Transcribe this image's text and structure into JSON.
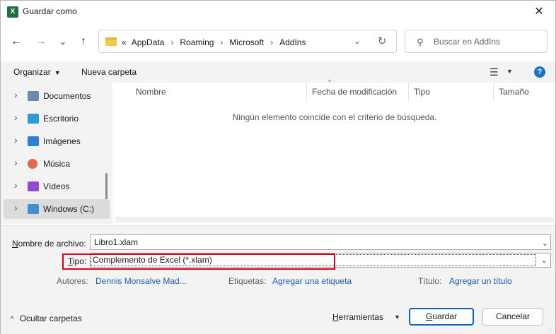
{
  "window": {
    "app_icon_letter": "X",
    "title": "Guardar como",
    "close_symbol": "✕"
  },
  "nav": {
    "back_symbol": "←",
    "forward_symbol": "→",
    "recent_symbol": "⌄",
    "up_symbol": "↑",
    "breadcrumb_overflow": "«",
    "breadcrumb": [
      "AppData",
      "Roaming",
      "Microsoft",
      "AddIns"
    ],
    "breadcrumb_separator": "›",
    "dropdown_symbol": "⌄",
    "refresh_symbol": "↻",
    "search_placeholder": "Buscar en AddIns"
  },
  "toolbar": {
    "organize_label": "Organizar",
    "new_folder_label": "Nueva carpeta",
    "view_symbol": "☰",
    "help_symbol": "?"
  },
  "sidebar": {
    "items": [
      {
        "label": "Documentos",
        "icon": "documents-icon",
        "color": "#6b8cae",
        "selected": false
      },
      {
        "label": "Escritorio",
        "icon": "desktop-icon",
        "color": "#2a9bd6",
        "selected": false
      },
      {
        "label": "Imágenes",
        "icon": "pictures-icon",
        "color": "#2f7fd0",
        "selected": false
      },
      {
        "label": "Música",
        "icon": "music-icon",
        "color": "#e0694f",
        "selected": false
      },
      {
        "label": "Vídeos",
        "icon": "videos-icon",
        "color": "#8e4bd1",
        "selected": false
      },
      {
        "label": "Windows (C:)",
        "icon": "drive-icon",
        "color": "#3d8fd6",
        "selected": true
      }
    ]
  },
  "file_list": {
    "columns": [
      "Nombre",
      "Fecha de modificación",
      "Tipo",
      "Tamaño"
    ],
    "empty_message": "Ningún elemento coincide con el criterio de búsqueda."
  },
  "form": {
    "filename_label_prefix": "N",
    "filename_label_rest": "ombre de archivo:",
    "filename_value": "Libro1.xlam",
    "type_label_prefix": "T",
    "type_label_rest": "ipo:",
    "type_value": "Complemento de Excel (*.xlam)",
    "authors_label": "Autores:",
    "authors_value": "Dennis Monsalve Mad...",
    "tags_label": "Etiquetas:",
    "tags_value": "Agregar una etiqueta",
    "title_label": "Título:",
    "title_value": "Agregar un título"
  },
  "footer": {
    "hide_folders_label": "Ocultar carpetas",
    "tools_label_prefix": "H",
    "tools_label_rest": "erramientas",
    "save_label_prefix": "G",
    "save_label_rest": "uardar",
    "cancel_label": "Cancelar"
  },
  "colors": {
    "accent": "#0a64c2",
    "highlight": "#e0001b",
    "link": "#1a5fb4",
    "excel_green": "#1d6f42"
  }
}
